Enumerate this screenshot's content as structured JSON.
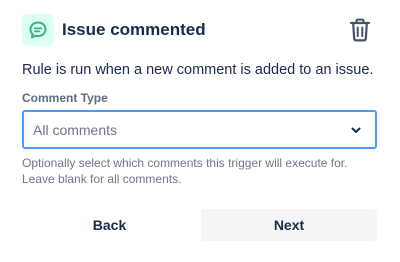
{
  "header": {
    "title": "Issue commented",
    "icon": "comment-icon",
    "icon_color": "#36b37e",
    "icon_bg": "#dcfff1",
    "delete_icon": "trash-icon"
  },
  "description": "Rule is run when a new comment is added to an issue.",
  "comment_type": {
    "label": "Comment Type",
    "selected": "All comments",
    "focus_color": "#4c9aff"
  },
  "help": {
    "line1": "Optionally select which comments this trigger will execute for.",
    "line2": "Leave blank for all comments."
  },
  "actions": {
    "back_label": "Back",
    "next_label": "Next"
  }
}
